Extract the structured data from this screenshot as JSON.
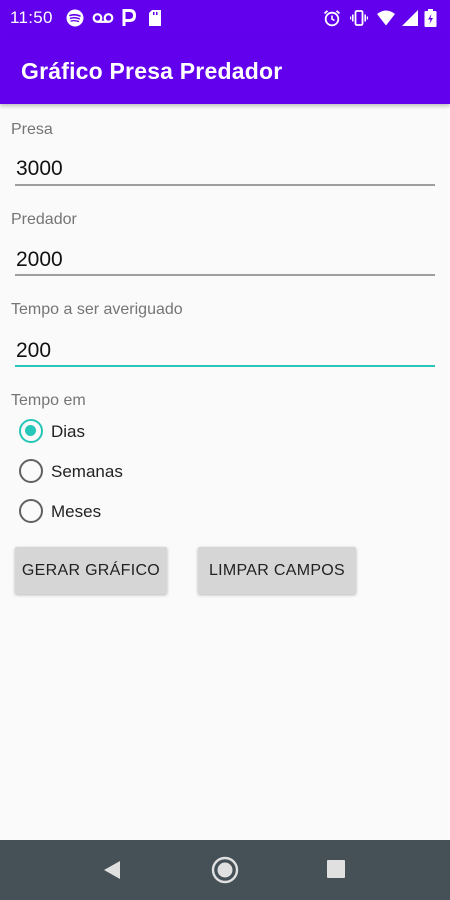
{
  "status_bar": {
    "time": "11:50",
    "left_icons": [
      "spotify-icon",
      "voicemail-icon",
      "parking-icon",
      "sd-card-icon"
    ],
    "right_icons": [
      "alarm-icon",
      "vibrate-icon",
      "wifi-icon",
      "signal-icon",
      "battery-icon"
    ]
  },
  "app_bar": {
    "title": "Gráfico Presa Predador",
    "color": "#6200ee"
  },
  "form": {
    "presa": {
      "label": "Presa",
      "value": "3000"
    },
    "predador": {
      "label": "Predador",
      "value": "2000"
    },
    "tempo": {
      "label": "Tempo a ser averiguado",
      "value": "200"
    },
    "tempo_em": {
      "label": "Tempo em",
      "options": [
        {
          "label": "Dias",
          "checked": true
        },
        {
          "label": "Semanas",
          "checked": false
        },
        {
          "label": "Meses",
          "checked": false
        }
      ]
    }
  },
  "buttons": {
    "gerar": "GERAR GRÁFICO",
    "limpar": "LIMPAR CAMPOS"
  },
  "accent_color": "#26c6b9",
  "nav_bar": {
    "buttons": [
      "back-icon",
      "home-icon",
      "recents-icon"
    ]
  }
}
